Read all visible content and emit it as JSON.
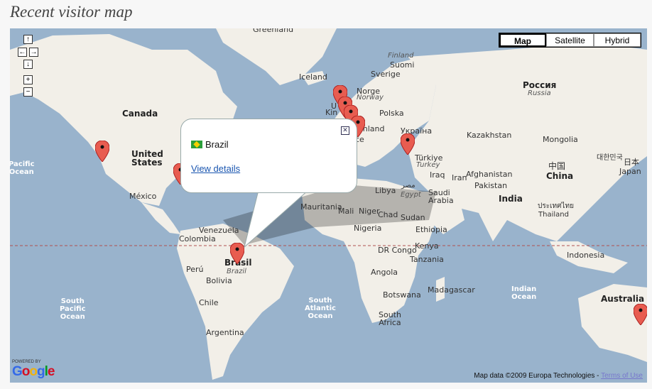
{
  "page": {
    "title": "Recent visitor map"
  },
  "map_type": {
    "map": "Map",
    "satellite": "Satellite",
    "hybrid": "Hybrid",
    "active": "Map"
  },
  "nav": {
    "up": "↑",
    "left": "←",
    "right": "→",
    "down": "↓",
    "zoom_in": "+",
    "zoom_out": "−"
  },
  "labels": {
    "greenland": "Greenland",
    "iceland": "Iceland",
    "sverige": "Sverige",
    "suomi": "Suomi",
    "finland": "Finland",
    "norge": "Norge",
    "norway": "Norway",
    "rossiya": "Россия",
    "russia": "Russia",
    "canada": "Canada",
    "united_states": "United\nStates",
    "mexico": "México",
    "pacific_ocean_n": "Pacific\nOcean",
    "polska": "Polska",
    "ukraina": "Україна",
    "turkiye": "Türkiye",
    "turkey": "Turkey",
    "kazakhstan": "Kazakhstan",
    "mongolia": "Mongolia",
    "china_zh": "中国",
    "china": "China",
    "korea": "대한민국",
    "japan_jp": "日本",
    "japan": "Japan",
    "iraq": "Iraq",
    "iran": "Iran",
    "afghanistan": "Afghanistan",
    "pakistan": "Pakistan",
    "india": "India",
    "thailand_th": "ประเทศไทย",
    "thailand": "Thailand",
    "saudi_arabia": "Saudi\nArabia",
    "libya": "Libya",
    "egypt_ar": "مصر",
    "egypt": "Egypt",
    "mauritania": "Mauritania",
    "mali": "Mali",
    "niger": "Niger",
    "chad": "Chad",
    "sudan": "Sudan",
    "nigeria": "Nigeria",
    "ethiopia": "Ethiopia",
    "kenya": "Kenya",
    "dr_congo": "DR Congo",
    "tanzania": "Tanzania",
    "angola": "Angola",
    "botswana": "Botswana",
    "madagascar": "Madagascar",
    "south_africa": "South\nAfrica",
    "venezuela": "Venezuela",
    "colombia": "Colombia",
    "peru": "Perú",
    "bolivia": "Bolivia",
    "brasil": "Brasil",
    "brazil": "Brazil",
    "chile": "Chile",
    "argentina": "Argentina",
    "indonesia": "Indonesia",
    "australia": "Australia",
    "pacific_ocean_s": "South\nPacific\nOcean",
    "atlantic_ocean_s": "South\nAtlantic\nOcean",
    "indian_ocean": "Indian\nOcean",
    "schland": "schland",
    "kin": "Kin",
    "u": "U",
    "ce": "ce",
    "pacific_left": "Pacific\nOcean"
  },
  "bubble": {
    "country": "Brazil",
    "link": "View details",
    "close": "✕"
  },
  "attribution": {
    "text": "Map data ©2009 Europa Technologies - ",
    "terms": "Terms of Use"
  },
  "google": {
    "powered": "POWERED BY",
    "word": "Google"
  },
  "colors": {
    "water": "#99b3cc",
    "land": "#f2efe8",
    "pin": "#e85c50",
    "equator": "#b05050"
  }
}
